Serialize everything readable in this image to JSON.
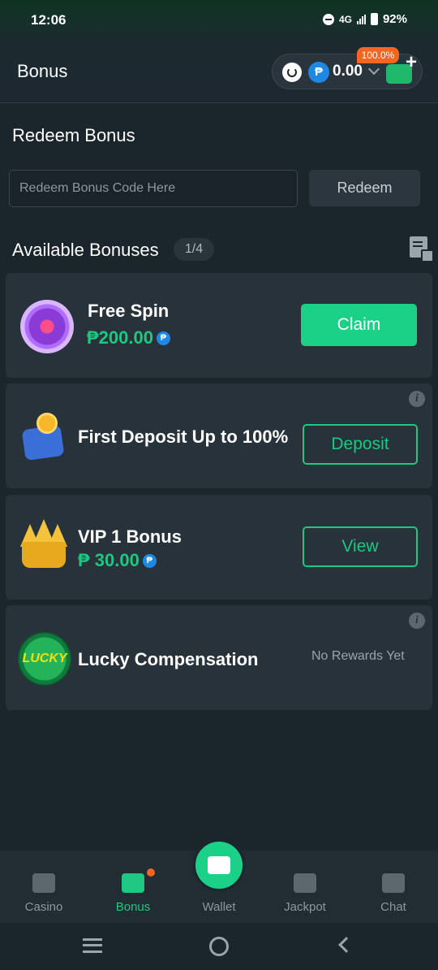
{
  "status_bar": {
    "time": "12:06",
    "network": "4G",
    "battery": "92%"
  },
  "header": {
    "title": "Bonus",
    "balance": "0.00",
    "currency_symbol": "₱",
    "percent_badge": "100.0%"
  },
  "redeem": {
    "title": "Redeem Bonus",
    "placeholder": "Redeem Bonus Code Here",
    "value": "",
    "button_label": "Redeem"
  },
  "available": {
    "title": "Available Bonuses",
    "count": "1/4"
  },
  "bonuses": [
    {
      "title": "Free Spin",
      "amount": "₱200.00",
      "coin": "₱",
      "button": "Claim",
      "icon": "spin-wheel-icon"
    },
    {
      "title": "First Deposit Up to 100%",
      "button": "Deposit",
      "icon": "wallet-coins-icon",
      "info": "i"
    },
    {
      "title": "VIP 1 Bonus",
      "amount": "₱ 30.00",
      "coin": "₱",
      "button": "View",
      "icon": "crown-icon"
    },
    {
      "title": "Lucky Compensation",
      "status": "No Rewards Yet",
      "icon": "lucky-badge-icon",
      "icon_text": "LUCKY",
      "info": "i"
    }
  ],
  "bottom_nav": {
    "items": [
      {
        "label": "Casino",
        "icon": "cards-icon",
        "active": false
      },
      {
        "label": "Bonus",
        "icon": "gift-icon",
        "active": true
      },
      {
        "label": "Wallet",
        "icon": "wallet-icon",
        "active": false
      },
      {
        "label": "Jackpot",
        "icon": "trophy-icon",
        "active": false
      },
      {
        "label": "Chat",
        "icon": "chat-icon",
        "active": false
      }
    ]
  },
  "colors": {
    "accent": "#1ec782",
    "button_fill": "#1bd188",
    "badge": "#f26522",
    "card_bg": "#27323a",
    "page_bg": "#1b252c"
  }
}
